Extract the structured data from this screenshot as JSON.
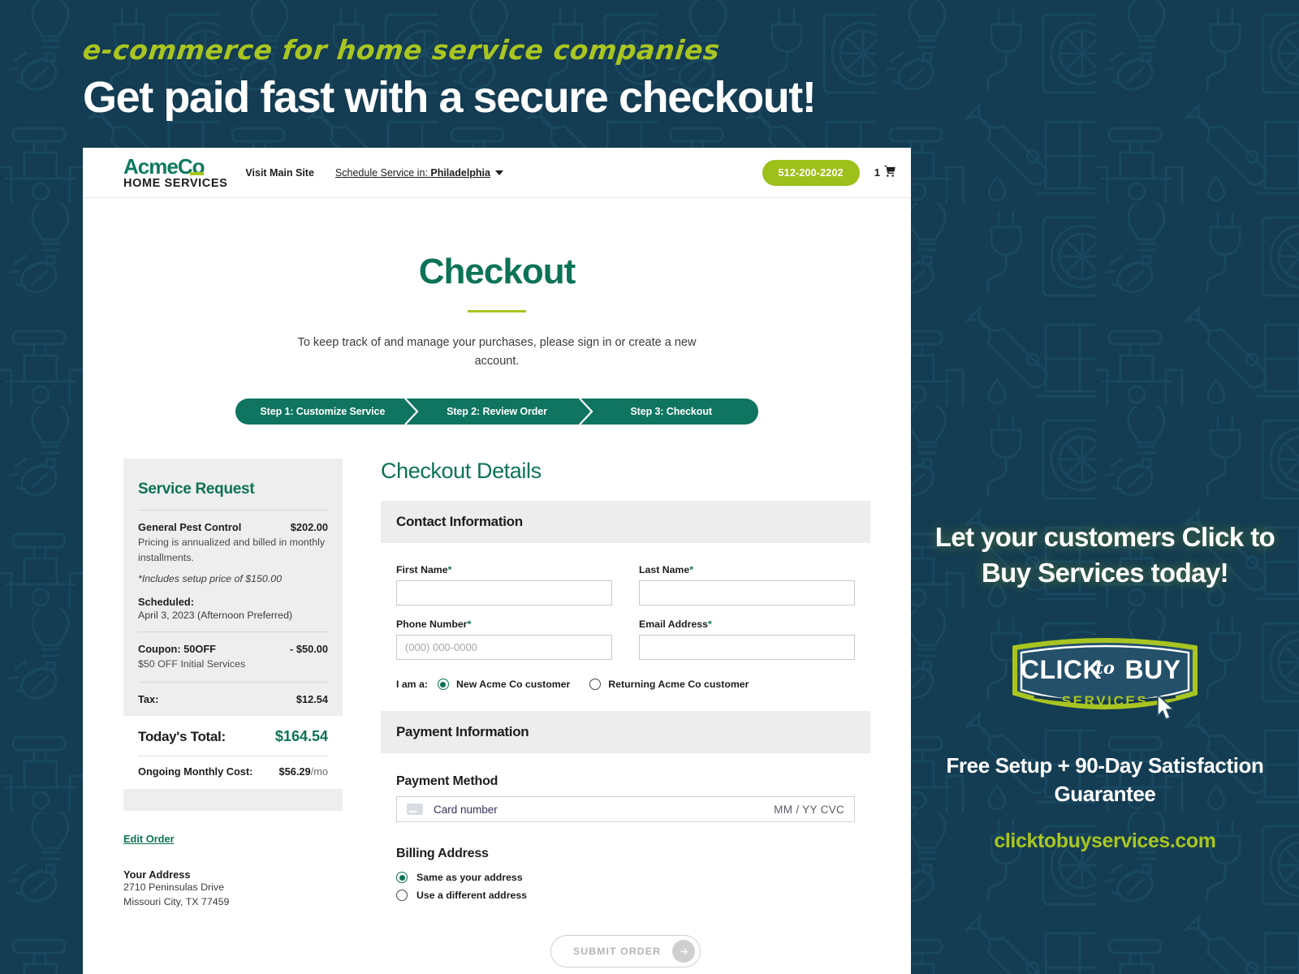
{
  "theme": {
    "bg_dark": "#143c52",
    "brand_green": "#0c7356",
    "lime": "#a9c520",
    "lime_button": "#9ec01b",
    "receipt_gray": "#eeeeee",
    "band_gray": "#ededed"
  },
  "marketing": {
    "kicker": "e-commerce for home service companies",
    "headline": "Get paid fast with a secure checkout!",
    "promo_headline": "Let your customers Click to Buy Services today!",
    "badge": {
      "line1": "CLICK",
      "to": "to",
      "line2": "BUY",
      "sub": "SERVICES"
    },
    "promo_footer": "Free Setup + 90-Day Satisfaction Guarantee",
    "url": "clicktobuyservices.com"
  },
  "site_header": {
    "logo_main": "AcmeCo",
    "logo_sub": "HOME SERVICES",
    "visit_main_site": "Visit Main Site",
    "schedule_prefix": "Schedule Service in: ",
    "schedule_city": "Philadelphia",
    "phone": "512-200-2202",
    "cart_count": "1",
    "cart_icon": "shopping-cart-icon",
    "caret_icon": "chevron-down-icon"
  },
  "page": {
    "title": "Checkout",
    "subtitle": "To keep track of and manage your purchases, please sign in or create a new account.",
    "steps": [
      {
        "label": "Step 1: Customize Service"
      },
      {
        "label": "Step 2: Review Order"
      },
      {
        "label": "Step 3: Checkout"
      }
    ]
  },
  "receipt": {
    "title": "Service Request",
    "item": {
      "name": "General Pest Control",
      "price": "$202.00",
      "note": "Pricing is annualized and billed in monthly installments.",
      "setup_note": "*Includes setup price of $150.00"
    },
    "scheduled_label": "Scheduled:",
    "scheduled_value": "April 3, 2023 (Afternoon Preferred)",
    "coupon": {
      "label": "Coupon: 50OFF",
      "amount": "- $50.00",
      "note": "$50 OFF Initial Services"
    },
    "tax": {
      "label": "Tax:",
      "amount": "$12.54"
    },
    "total": {
      "label": "Today's Total:",
      "amount": "$164.54"
    },
    "monthly": {
      "label": "Ongoing Monthly Cost:",
      "amount": "$56.29",
      "suffix": "/mo"
    },
    "edit_order": "Edit Order",
    "address_title": "Your Address",
    "address_line1": "2710 Peninsulas Drive",
    "address_line2": "Missouri City, TX 77459"
  },
  "form": {
    "section_title": "Checkout Details",
    "contact_band": "Contact Information",
    "first_name": {
      "label": "First Name",
      "required": "*",
      "value": "",
      "placeholder": ""
    },
    "last_name": {
      "label": "Last Name",
      "required": "*",
      "value": "",
      "placeholder": ""
    },
    "phone": {
      "label": "Phone Number",
      "required": "*",
      "value": "",
      "placeholder": "(000) 000-0000"
    },
    "email": {
      "label": "Email Address",
      "required": "*",
      "value": "",
      "placeholder": ""
    },
    "i_am_a": "I am a:",
    "customer_options": [
      {
        "label": "New Acme Co customer",
        "selected": true
      },
      {
        "label": "Returning Acme Co customer",
        "selected": false
      }
    ],
    "payment_band": "Payment Information",
    "payment_method_label": "Payment Method",
    "card": {
      "placeholder": "Card number",
      "expiry_cvc": "MM / YY  CVC",
      "icon": "credit-card-icon"
    },
    "billing_label": "Billing Address",
    "billing_options": [
      {
        "label": "Same as your address",
        "selected": true
      },
      {
        "label": "Use a different address",
        "selected": false
      }
    ],
    "submit_label": "SUBMIT ORDER",
    "submit_icon": "arrow-right-icon"
  }
}
